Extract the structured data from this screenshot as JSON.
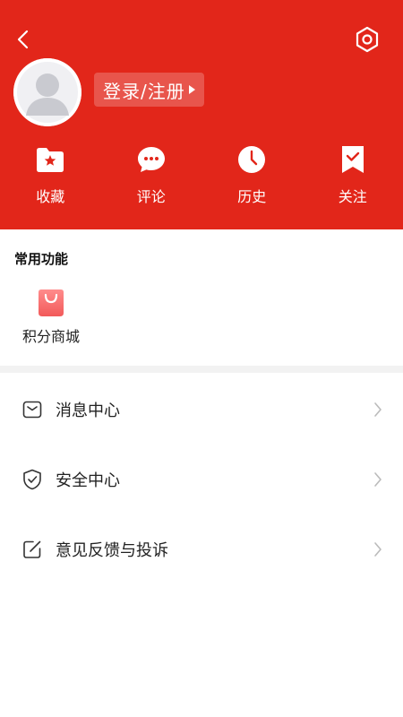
{
  "header": {
    "login_label": "登录/注册",
    "accent_color": "#E2261A"
  },
  "icons": {
    "back": "chevron-left-icon",
    "settings": "settings-hexagon-icon",
    "avatar": "user-avatar-placeholder"
  },
  "quick_actions": [
    {
      "label": "收藏",
      "icon": "folder-star-icon"
    },
    {
      "label": "评论",
      "icon": "chat-bubble-icon"
    },
    {
      "label": "历史",
      "icon": "clock-icon"
    },
    {
      "label": "关注",
      "icon": "bookmark-check-icon"
    }
  ],
  "common_functions": {
    "title": "常用功能",
    "items": [
      {
        "label": "积分商城",
        "icon": "shopping-bag-icon"
      }
    ]
  },
  "menu": [
    {
      "label": "消息中心",
      "icon": "mail-icon"
    },
    {
      "label": "安全中心",
      "icon": "shield-check-icon"
    },
    {
      "label": "意见反馈与投诉",
      "icon": "edit-square-icon"
    }
  ]
}
